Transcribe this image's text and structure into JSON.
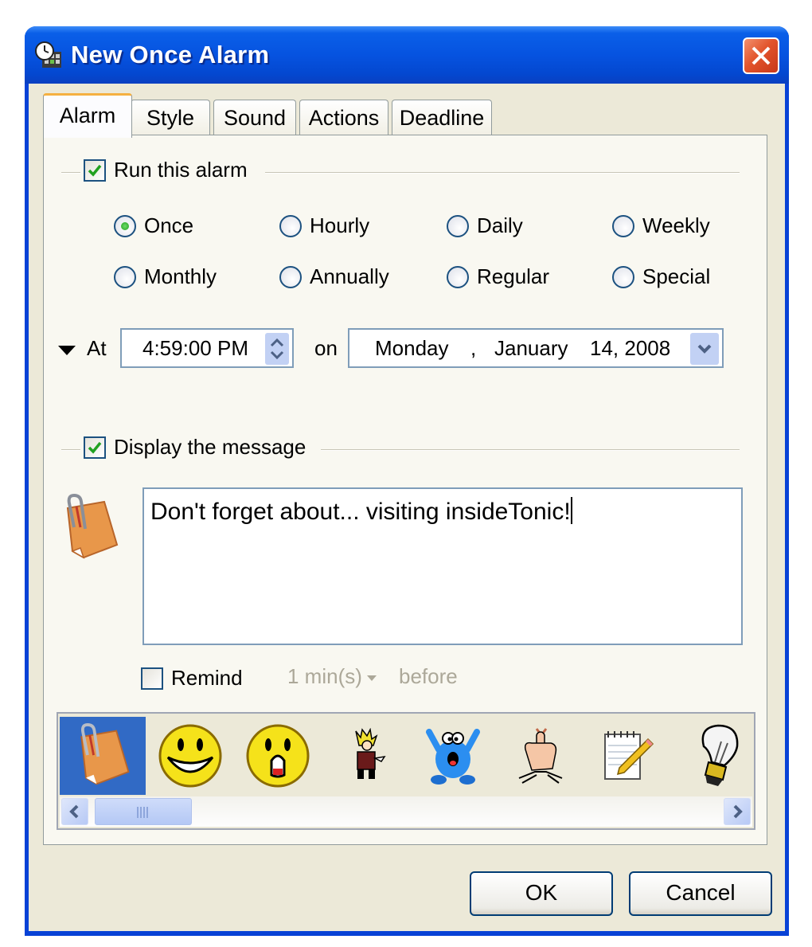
{
  "window": {
    "title": "New Once Alarm",
    "app_icon": "alarm-clock-icon",
    "close_icon": "close-icon"
  },
  "tabs": [
    {
      "label": "Alarm",
      "active": true
    },
    {
      "label": "Style",
      "active": false
    },
    {
      "label": "Sound",
      "active": false
    },
    {
      "label": "Actions",
      "active": false
    },
    {
      "label": "Deadline",
      "active": false
    }
  ],
  "run_alarm": {
    "label": "Run this alarm",
    "checked": true
  },
  "frequency": {
    "selected": "Once",
    "options": [
      "Once",
      "Hourly",
      "Daily",
      "Weekly",
      "Monthly",
      "Annually",
      "Regular",
      "Special"
    ]
  },
  "schedule": {
    "at_label": "At",
    "time_value": "4:59:00 PM",
    "on_label": "on",
    "date_weekday": "Monday",
    "date_separator": ",",
    "date_month": "January",
    "date_day_year": "14, 2008"
  },
  "message": {
    "label": "Display the message",
    "checked": true,
    "text": "Don't forget about... visiting insideTonic!",
    "icon": "note-paperclip-icon"
  },
  "remind": {
    "label": "Remind",
    "checked": false,
    "interval_value": "1 min(s)",
    "before_label": "before"
  },
  "icon_gallery": {
    "items": [
      {
        "name": "note-paperclip-icon",
        "selected": true
      },
      {
        "name": "grinning-smiley-icon",
        "selected": false
      },
      {
        "name": "surprised-smiley-icon",
        "selected": false
      },
      {
        "name": "cartoon-boy-icon",
        "selected": false
      },
      {
        "name": "blue-monster-icon",
        "selected": false
      },
      {
        "name": "string-finger-reminder-icon",
        "selected": false
      },
      {
        "name": "notepad-pencil-icon",
        "selected": false
      },
      {
        "name": "lightbulb-icon",
        "selected": false
      }
    ]
  },
  "buttons": {
    "ok_label": "OK",
    "cancel_label": "Cancel"
  }
}
